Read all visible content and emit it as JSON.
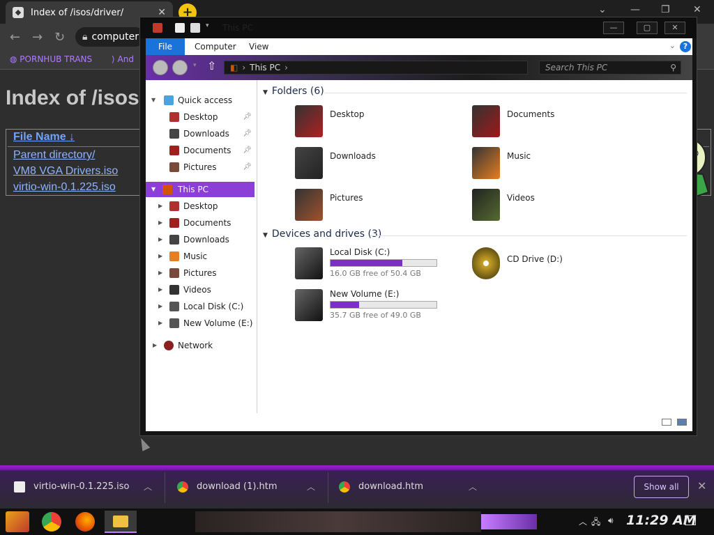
{
  "browser": {
    "tab_title": "Index of /isos/driver/",
    "tab_close": "✕",
    "new_tab": "+",
    "address": "computer",
    "win_controls": [
      "⌄",
      "—",
      "❐",
      "✕"
    ],
    "bookmarks": [
      "PORNHUB TRANS",
      "And"
    ]
  },
  "page": {
    "heading": "Index of /isos",
    "column_header": "File Name",
    "sort_indicator": "↓",
    "rows": [
      "Parent directory/",
      "VM8 VGA Drivers.iso",
      "virtio-win-0.1.225.iso"
    ]
  },
  "explorer": {
    "title": "This PC",
    "title_controls": [
      "—",
      "▢",
      "✕"
    ],
    "ribbon_tabs": [
      "File",
      "Computer",
      "View"
    ],
    "ribbon_expand": "⌄",
    "help": "?",
    "address_path": "This PC",
    "search_placeholder": "Search This PC",
    "nav": {
      "quick_access": "Quick access",
      "quick_items": [
        "Desktop",
        "Downloads",
        "Documents",
        "Pictures"
      ],
      "this_pc": "This PC",
      "pc_items": [
        "Desktop",
        "Documents",
        "Downloads",
        "Music",
        "Pictures",
        "Videos",
        "Local Disk (C:)",
        "New Volume (E:)"
      ],
      "network": "Network"
    },
    "folders_header": "Folders (6)",
    "folders": [
      "Desktop",
      "Documents",
      "Downloads",
      "Music",
      "Pictures",
      "Videos"
    ],
    "drives_header": "Devices and drives (3)",
    "drives": [
      {
        "name": "Local Disk (C:)",
        "free": "16.0 GB free of 50.4 GB",
        "used_fraction": 0.68
      },
      {
        "name": "New Volume (E:)",
        "free": "35.7 GB free of 49.0 GB",
        "used_fraction": 0.27
      },
      {
        "name": "CD Drive (D:)"
      }
    ],
    "accent_color": "#8b3fd6"
  },
  "downloads": {
    "items": [
      "virtio-win-0.1.225.iso",
      "download (1).htm",
      "download.htm"
    ],
    "show_all": "Show all",
    "close": "✕"
  },
  "taskbar": {
    "clock": "11:29 AM"
  }
}
